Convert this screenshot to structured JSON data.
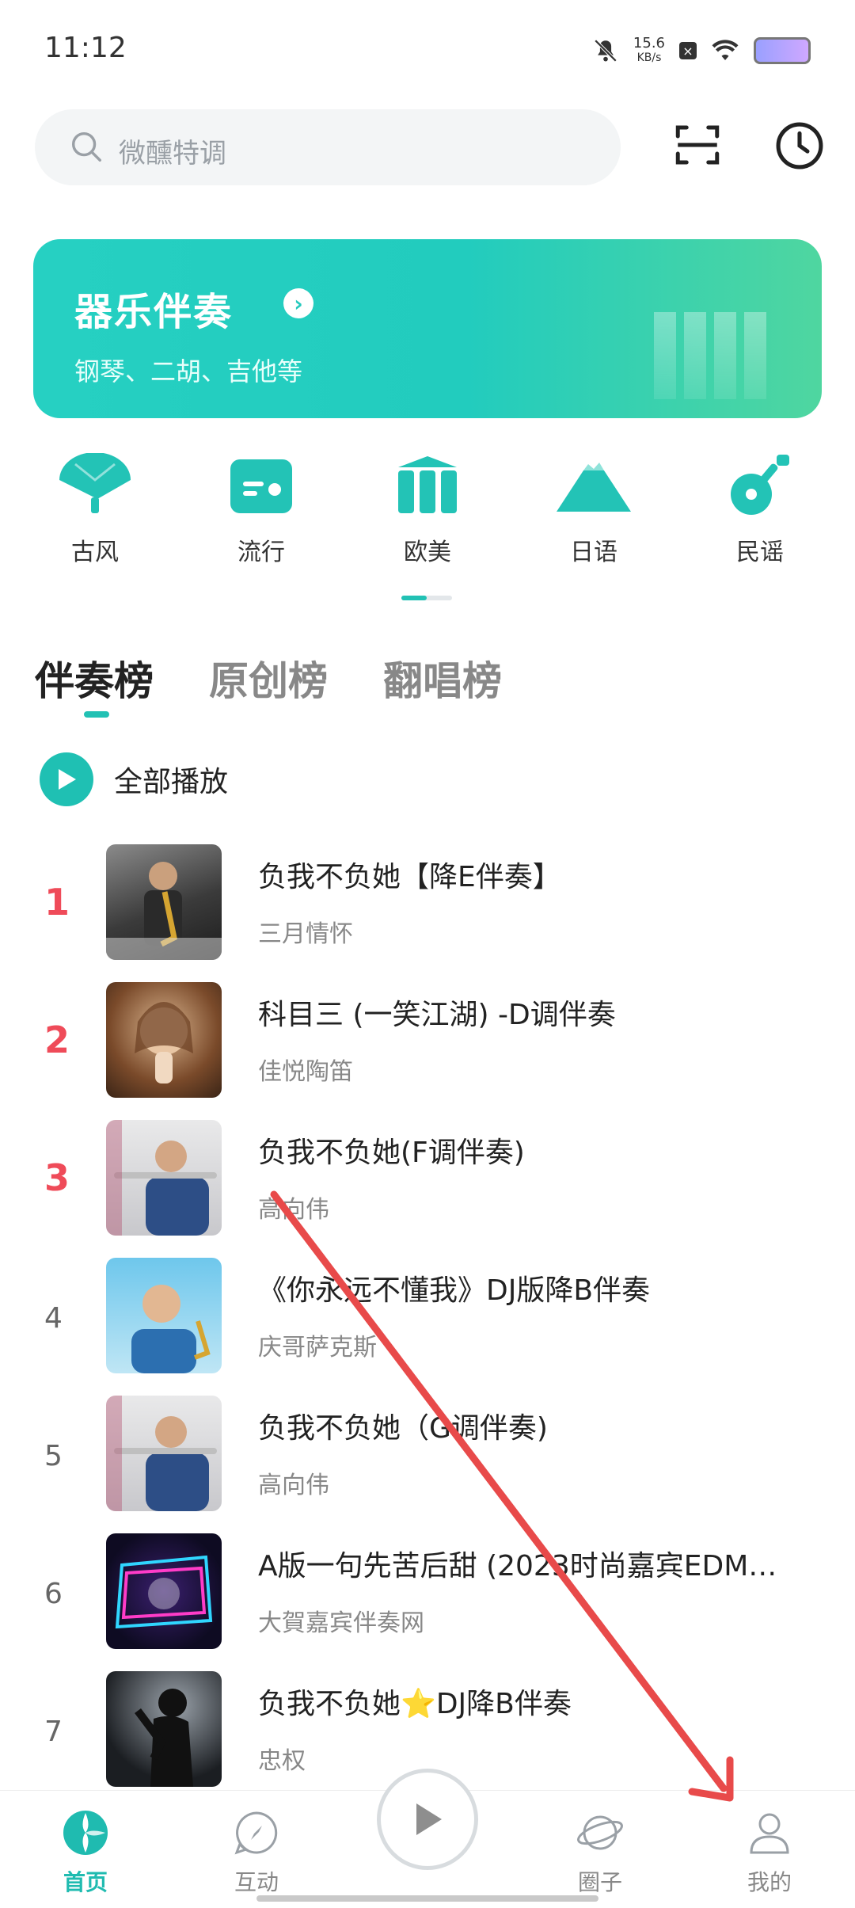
{
  "status_bar": {
    "time": "11:12",
    "speed_value": "15.6",
    "speed_unit": "KB/s"
  },
  "search": {
    "placeholder": "微醺特调"
  },
  "banner": {
    "title": "器乐伴奏",
    "subtitle": "钢琴、二胡、吉他等"
  },
  "categories": [
    {
      "label": "古风",
      "icon": "fan-icon"
    },
    {
      "label": "流行",
      "icon": "radio-icon"
    },
    {
      "label": "欧美",
      "icon": "columns-icon"
    },
    {
      "label": "日语",
      "icon": "mountain-icon"
    },
    {
      "label": "民谣",
      "icon": "guitar-icon"
    }
  ],
  "tabs": [
    {
      "label": "伴奏榜",
      "active": true
    },
    {
      "label": "原创榜",
      "active": false
    },
    {
      "label": "翻唱榜",
      "active": false
    }
  ],
  "play_all": "全部播放",
  "songs": [
    {
      "rank": "1",
      "title": "负我不负她【降E伴奏】",
      "artist": "三月情怀"
    },
    {
      "rank": "2",
      "title": "科目三 (一笑江湖) -D调伴奏",
      "artist": "佳悦陶笛"
    },
    {
      "rank": "3",
      "title": "负我不负她(F调伴奏)",
      "artist": "高向伟"
    },
    {
      "rank": "4",
      "title": "《你永远不懂我》DJ版降B伴奏",
      "artist": "庆哥萨克斯"
    },
    {
      "rank": "5",
      "title": "负我不负她（G调伴奏)",
      "artist": "高向伟"
    },
    {
      "rank": "6",
      "title": "A版一句先苦后甜 (2023时尚嘉宾EDM…",
      "artist": "大賀嘉宾伴奏网"
    },
    {
      "rank": "7",
      "title": "负我不负她⭐DJ降B伴奏",
      "artist": "忠权"
    }
  ],
  "bottom_nav": {
    "home": "首页",
    "interact": "互动",
    "circle": "圈子",
    "mine": "我的"
  },
  "colors": {
    "accent": "#1fc0b3",
    "rank_top": "#ef4b59",
    "annotation_arrow": "#e84a4a"
  }
}
